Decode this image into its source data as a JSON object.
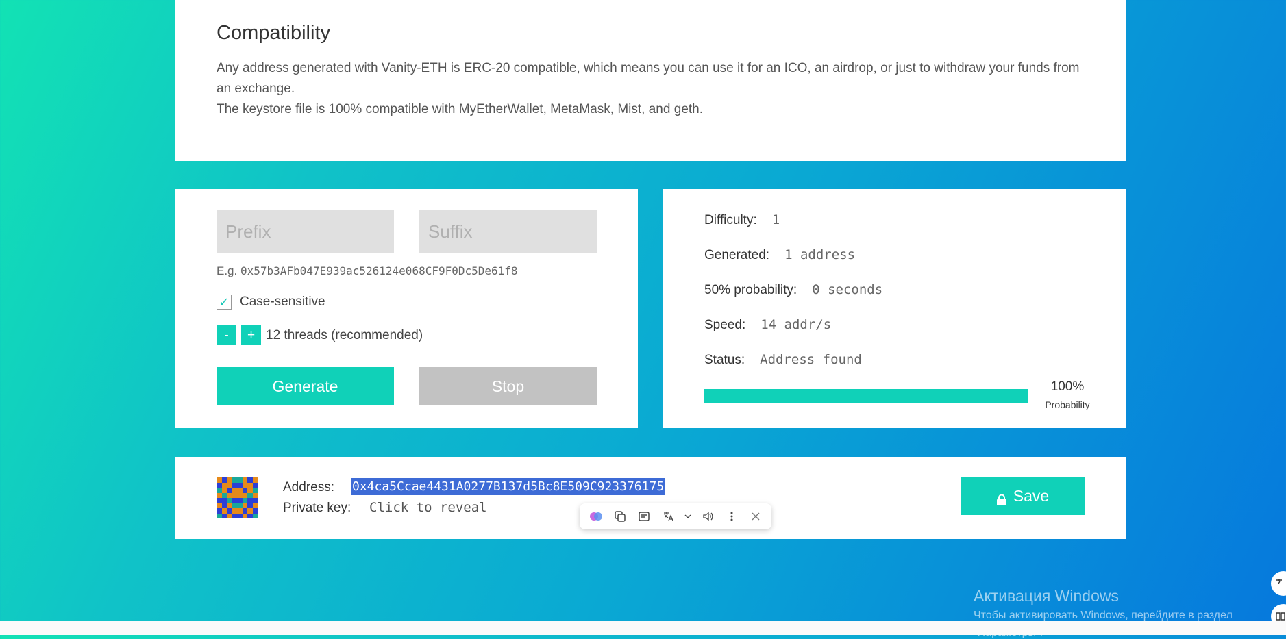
{
  "compatibility": {
    "title": "Compatibility",
    "line1": "Any address generated with Vanity-ETH is ERC-20 compatible, which means you can use it for an ICO, an airdrop, or just to withdraw your funds from an exchange.",
    "line2": "The keystore file is 100% compatible with MyEtherWallet, MetaMask, Mist, and geth."
  },
  "input_panel": {
    "prefix_placeholder": "Prefix",
    "suffix_placeholder": "Suffix",
    "example_prefix": "E.g.",
    "example_address": "0x57b3AFb047E939ac526124e068CF9F0Dc5De61f8",
    "case_sensitive_label": "Case-sensitive",
    "case_sensitive_checked": true,
    "threads_minus": "-",
    "threads_plus": "+",
    "threads_label": "12 threads (recommended)",
    "generate_label": "Generate",
    "stop_label": "Stop"
  },
  "stats": {
    "difficulty_label": "Difficulty:",
    "difficulty_value": "1",
    "generated_label": "Generated:",
    "generated_value": "1 address",
    "probability50_label": "50% probability:",
    "probability50_value": "0 seconds",
    "speed_label": "Speed:",
    "speed_value": "14 addr/s",
    "status_label": "Status:",
    "status_value": "Address found",
    "probability_percent": "100%",
    "probability_fraction": 1.0,
    "probability_caption": "Probability"
  },
  "result": {
    "address_label": "Address:",
    "address_value": "0x4ca5Ccae4431A0277B137d5Bc8E509C923376175",
    "private_key_label": "Private key:",
    "private_key_value": "Click to reveal",
    "save_label": "Save"
  },
  "colors": {
    "accent": "#10d1b8",
    "stop_button": "#c2c2c2",
    "selection": "#3d6bd6",
    "identicon": [
      "#e68a1a",
      "#2c3fd6",
      "#1aa89a"
    ]
  },
  "browser_toolbar": {
    "icons": [
      "brain-icon",
      "copy-icon",
      "notes-icon",
      "translate-icon",
      "chevron-down-icon",
      "speaker-icon",
      "more-icon",
      "close-icon"
    ]
  },
  "windows_watermark": {
    "title": "Активация Windows",
    "line1": "Чтобы активировать Windows, перейдите в раздел",
    "line2": "\"Параметры\"."
  }
}
